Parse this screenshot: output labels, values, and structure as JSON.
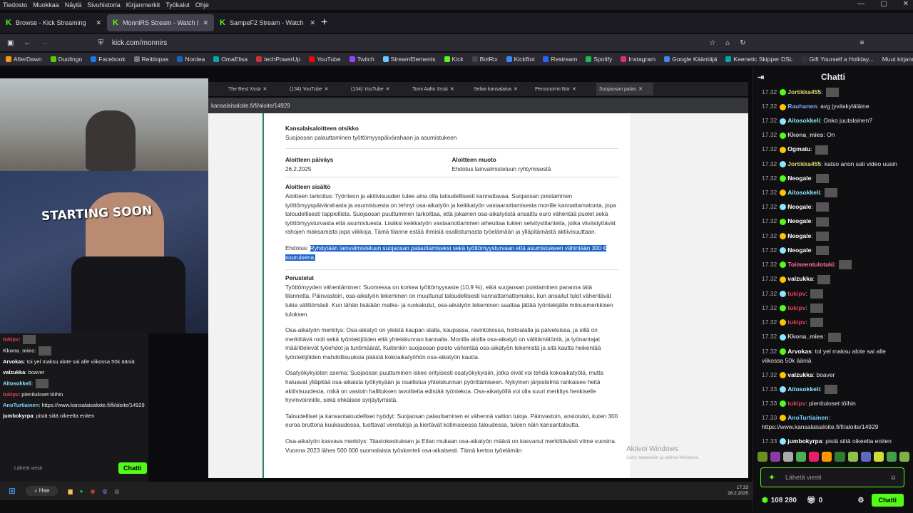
{
  "menubar": [
    "Tiedosto",
    "Muokkaa",
    "Näytä",
    "Sivuhistoria",
    "Kirjanmerkit",
    "Työkalut",
    "Ohje"
  ],
  "tabs": [
    {
      "label": "Browse - Kick Streaming",
      "active": false
    },
    {
      "label": "MonniRS Stream - Watch Li",
      "active": true
    },
    {
      "label": "SampeF2 Stream - Watch Li",
      "active": false
    }
  ],
  "url": "kick.com/monnirs",
  "bookmarks": [
    "AfterDawn",
    "Duolingo",
    "Facebook",
    "Reittiopas",
    "Nordea",
    "OmaElisa",
    "techPowerUp",
    "YouTube",
    "Twitch",
    "StreamElements",
    "Kick",
    "BotRix",
    "KickBot",
    "Restream",
    "Spotify",
    "Instagram",
    "Google Kääntäjä",
    "Keenetic Skipper DSL",
    "Gift Yourself a Holiday..."
  ],
  "bookmarks_other": "Muut kirjanmerkit",
  "cam_overlay": "STARTING SOON",
  "inner_tabs": [
    "The Best Xssä",
    "(134) YouTube",
    "(134) YouTube",
    "Tomi Aalto Xssä",
    "Selaa kansalaisa",
    "Perusnormi Nor",
    "Suojaosan palau"
  ],
  "inner_url": "kansalaisaloite.fi/fi/aloite/14929",
  "doc": {
    "title_label": "Kansalaisaloitteen otsikko",
    "title": "Suojaosan palauttaminen työttömyyspäivärahaan ja asumistukeen",
    "date_label": "Aloitteen päiväys",
    "date": "26.2.2025",
    "type_label": "Aloitteen muoto",
    "type": "Ehdotus lainvalmisteluun ryhtymisestä",
    "content_label": "Aloitteen sisältö",
    "content": "Aloitteen tarkoitus: Työnteon ja aktiivisuuden tulee aina olla taloudellisesti kannattavaa. Suojaosan poistaminen työttömyyspäivärahasta ja asumistuesta on tehnyt osa-aikatyön ja keikkatyön vastaanottamisesta monille kannattamatonta, jopa taloudellisesti tappiollista. Suojaosan puuttuminen tarkoittaa, että jokainen osa-aikatyöstä ansaittu euro vähentää puolet sekä työttömyysturvasta että asumistuesta. Lisäksi keikkatyön vastaanottaminen aiheuttaa tukien selvitystilanteita, jotka viivästyttävät rahojen maksamista jopa viikkoja. Tämä tilanne estää ihmisiä osallistumasta työelämään ja ylläpitämästä aktiivisuuttaan.",
    "proposal_prefix": "Ehdotus: ",
    "proposal": "Ryhdytään lainvalmisteluun suojaosan palauttamiseksi sekä työttömyysturvaan että asumistukeen vähintään 300 € suuruisena.",
    "reasons_label": "Perustelut",
    "p1": "Työttömyyden vähentäminen: Suomessa on korkea työttömyysaste (10,9 %), eikä suojaosan poistaminen paranna tätä tilannetta. Päinvastoin, osa-aikatyön tekeminen on muuttunut taloudellisesti kannattamattomaksi, kun ansaitut tulot vähentävät tukia välittömästi. Kun tähän lisätään matka- ja ruokakulut, osa-aikatyön tekeminen saattaa jättää työntekijälle miinusmerkkisen tuloksen.",
    "p2": "Osa-aikatyön merkitys: Osa-aikatyö on yleistä kaupan alalla, kaupassa, ravintoloissa, hoitoalalla ja palveluissa, ja sillä on merkittävä rooli sekä työntekijöiden että yhteiskunnan kannalta. Monilla aloilla osa-aikatyö on välttämätöntä, ja työnantajat määrittelevät työehdot ja tuntimäärät. Kuitenkin suojaosan poisto vähentää osa-aikatyön tekemistä ja sitä kautta heikentää työntekijöiden mahdollisuuksia päästä kokoaikatyöhön osa-aikatyön kautta.",
    "p3": "Osatyökykyisten asema: Suojaosan puuttuminen iskee erityisesti osatyökykyisiin, jotka eivät voi tehdä kokoaikatyötä, mutta haluavat ylläpitää osa-aikaista työkykyään ja osallistua yhteiskunnan pyörittämiseen. Nykyinen järjestelmä rankaisee heitä aktiivisuudesta, mikä on vastoin hallituksen tavoitteita edistää työntekoa. Osa-aikatyöllä voi olla suuri merkitys henkiselle hyvinvoinnille, sekä ehkäisee syrjäytymistä.",
    "p4": "Taloudelliset ja kansantaloudelliset hyödyt: Suojaosan palauttaminen ei vähennä valtion tuloja. Päinvastoin, ansiotulot, kuten 300 euroa bruttona kuukaudessa, tuottavat verotuloja ja kiertävät kotimaisessa taloudessa, tukien näin kansantaloutta.",
    "p5": "Osa-aikatyön kasvava merkitys: Tilastokeskuksen ja Etlan mukaan osa-aikatyön määrä on kasvanut merkittävästi viime vuosina. Vuonna 2023 lähes 500 000 suomalaista työskenteli osa-aikaisesti. Tämä kertoo työelämän"
  },
  "watermark": {
    "title": "Aktivoi Windows",
    "sub": "Siirry asetuksiin ja aktivoi Windows."
  },
  "left_chat": [
    {
      "user": "tukipv",
      "text": "",
      "color": "#e0425e"
    },
    {
      "user": "Kkona_mies",
      "text": "",
      "color": "#bbbbbb"
    },
    {
      "user": "Arvokas",
      "text": "toi yel maksu alote sai alle viikossa 50k ääniä",
      "color": "#ffffff"
    },
    {
      "user": "valzukka",
      "text": "boaver",
      "color": "#ffffff"
    },
    {
      "user": "Aitosokkeli",
      "text": "",
      "color": "#8de6ff"
    },
    {
      "user": "tukipv",
      "text": "pienituloset töihin",
      "color": "#e0425e"
    },
    {
      "user": "AnoTurtiainen",
      "text": "https://www.kansalaisaloite.fi/fi/aloite/14929",
      "color": "#7cd3ff"
    },
    {
      "user": "jumbokyrpa",
      "text": "pistä siitä oikeelta eniten",
      "color": "#ffffff"
    }
  ],
  "left_chat_input": "Lähetä viesti",
  "left_chat_button": "Chatti",
  "chat": {
    "title": "Chatti",
    "messages": [
      {
        "time": "17.32",
        "user": "Jortikka455",
        "text": "",
        "color": "#dcd46b",
        "emote": true
      },
      {
        "time": "17.32",
        "user": "Rauhanen",
        "text": "avg jyväskyläläine",
        "color": "#7fa8ff",
        "emote": false
      },
      {
        "time": "17.32",
        "user": "Aitosokkeli",
        "text": "Onko juutalainen?",
        "color": "#8de6ff",
        "emote": false
      },
      {
        "time": "17.32",
        "user": "Kkona_mies",
        "text": "On",
        "color": "#cccccc",
        "emote": false
      },
      {
        "time": "17.32",
        "user": "Ogmatu",
        "text": "",
        "color": "#ffffff",
        "emote": true
      },
      {
        "time": "17.32",
        "user": "Jortikka455",
        "text": "katso anon sali video uusin",
        "color": "#dcd46b",
        "emote": false
      },
      {
        "time": "17.32",
        "user": "Neogale",
        "text": "",
        "color": "#ffffff",
        "emote": true
      },
      {
        "time": "17.32",
        "user": "Aitosokkeli",
        "text": "",
        "color": "#8de6ff",
        "emote": true
      },
      {
        "time": "17.32",
        "user": "Neogale",
        "text": "",
        "color": "#ffffff",
        "emote": true
      },
      {
        "time": "17.32",
        "user": "Neogale",
        "text": "",
        "color": "#ffffff",
        "emote": true
      },
      {
        "time": "17.32",
        "user": "Neogale",
        "text": "",
        "color": "#ffffff",
        "emote": true
      },
      {
        "time": "17.32",
        "user": "Neogale",
        "text": "",
        "color": "#ffffff",
        "emote": true
      },
      {
        "time": "17.32",
        "user": "Toimeentulotuki",
        "text": "",
        "color": "#ff6e95",
        "emote": true
      },
      {
        "time": "17.32",
        "user": "valzukka",
        "text": "",
        "color": "#ffffff",
        "emote": true
      },
      {
        "time": "17.32",
        "user": "tukipv",
        "text": "",
        "color": "#e0425e",
        "emote": true
      },
      {
        "time": "17.32",
        "user": "tukipv",
        "text": "",
        "color": "#e0425e",
        "emote": true
      },
      {
        "time": "17.32",
        "user": "tukipv",
        "text": "",
        "color": "#e0425e",
        "emote": true
      },
      {
        "time": "17.32",
        "user": "Kkona_mies",
        "text": "",
        "color": "#cccccc",
        "emote": true
      },
      {
        "time": "17.32",
        "user": "Arvokas",
        "text": "toi yel maksu alote sai alle viikossa 50k ääniä",
        "color": "#ffffff",
        "emote": false
      },
      {
        "time": "17.32",
        "user": "valzukka",
        "text": "boaver",
        "color": "#ffffff",
        "emote": false
      },
      {
        "time": "17.33",
        "user": "Aitosokkeli",
        "text": "",
        "color": "#8de6ff",
        "emote": true
      },
      {
        "time": "17.33",
        "user": "tukipv",
        "text": "pienituloset töihin",
        "color": "#e0425e",
        "emote": false
      },
      {
        "time": "17.33",
        "user": "AnoTurtiainen",
        "text": "https://www.kansalaisaloite.fi/fi/aloite/14929",
        "color": "#7cd3ff",
        "emote": false
      },
      {
        "time": "17.33",
        "user": "jumbokyrpa",
        "text": "pistä siitä oikeelta eniten",
        "color": "#ffffff",
        "emote": false
      }
    ],
    "input_placeholder": "Lähetä viesti",
    "points": "108 280",
    "gifts": "0",
    "send_button": "Chatti"
  },
  "taskbar": {
    "search": "Hae",
    "time": "17.33",
    "date": "28.2.2025"
  },
  "colors": {
    "kick_green": "#53fc18",
    "highlight": "#1d64c9",
    "doc_border": "#2f7e74"
  }
}
